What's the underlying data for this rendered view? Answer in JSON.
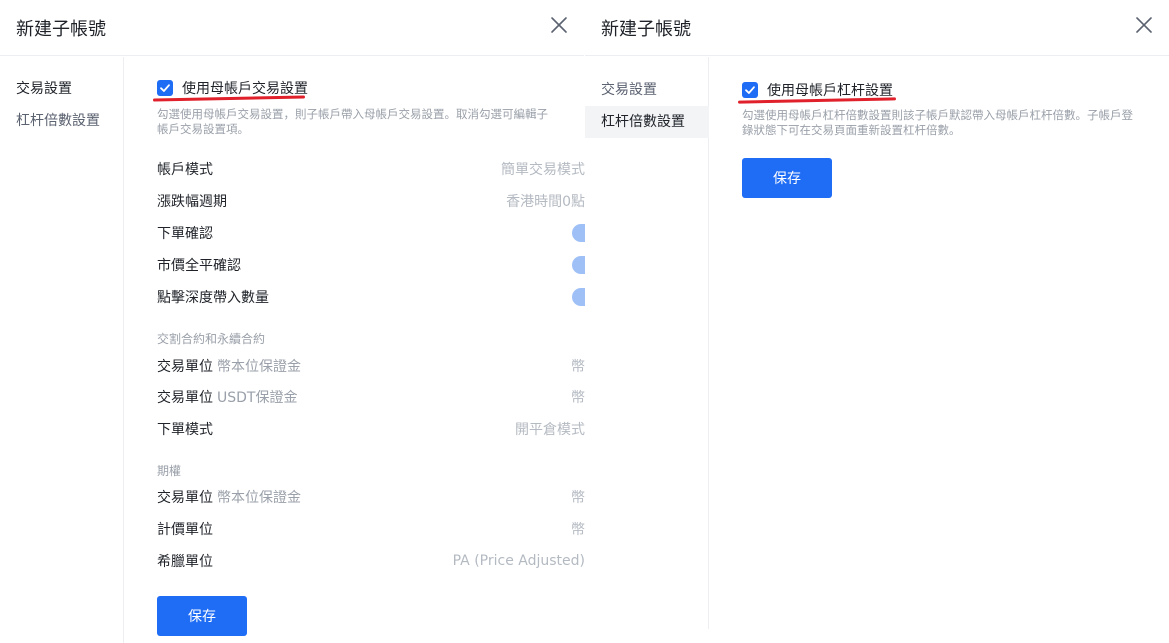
{
  "colors": {
    "accent": "#1f6cf5",
    "annotation": "#e0202a",
    "toggle_on": "#9ec0f7"
  },
  "left_panel": {
    "title": "新建子帳號",
    "close_icon": "close-icon",
    "nav": [
      {
        "label": "交易設置"
      },
      {
        "label": "杠杆倍數設置"
      }
    ],
    "checkbox": {
      "label": "使用母帳戶交易設置",
      "checked": true
    },
    "description": [
      "勾選使用母帳戶交易設置，則子帳戶帶入母帳戶交易設置。取消勾選可編輯子",
      "帳戶交易設置項。"
    ],
    "general_settings": [
      {
        "label": "帳戶模式",
        "value": "簡單交易模式"
      },
      {
        "label": "漲跌幅週期",
        "value": "香港時間0點"
      },
      {
        "label": "下單確認",
        "toggle": true
      },
      {
        "label": "市價全平確認",
        "toggle": true
      },
      {
        "label": "點擊深度帶入數量",
        "toggle": true
      }
    ],
    "futures_section": {
      "title": "交割合約和永續合約",
      "rows": [
        {
          "label": "交易單位",
          "sub": "幣本位保證金",
          "value": "幣"
        },
        {
          "label": "交易單位",
          "sub": "USDT保證金",
          "value": "幣"
        },
        {
          "label": "下單模式",
          "sub": "",
          "value": "開平倉模式"
        }
      ]
    },
    "options_section": {
      "title": "期權",
      "rows": [
        {
          "label": "交易單位",
          "sub": "幣本位保證金",
          "value": "幣"
        },
        {
          "label": "計價單位",
          "sub": "",
          "value": "幣"
        },
        {
          "label": "希臘單位",
          "sub": "",
          "value": "PA (Price Adjusted)"
        }
      ]
    },
    "save_label": "保存"
  },
  "right_panel": {
    "title": "新建子帳號",
    "close_icon": "close-icon",
    "nav": [
      {
        "label": "交易設置"
      },
      {
        "label": "杠杆倍數設置"
      }
    ],
    "checkbox": {
      "label": "使用母帳戶杠杆設置",
      "checked": true
    },
    "description": [
      "勾選使用母帳戶杠杆倍數設置則該子帳戶默認帶入母帳戶杠杆倍數。子帳戶登",
      "錄狀態下可在交易頁面重新設置杠杆倍數。"
    ],
    "save_label": "保存"
  }
}
